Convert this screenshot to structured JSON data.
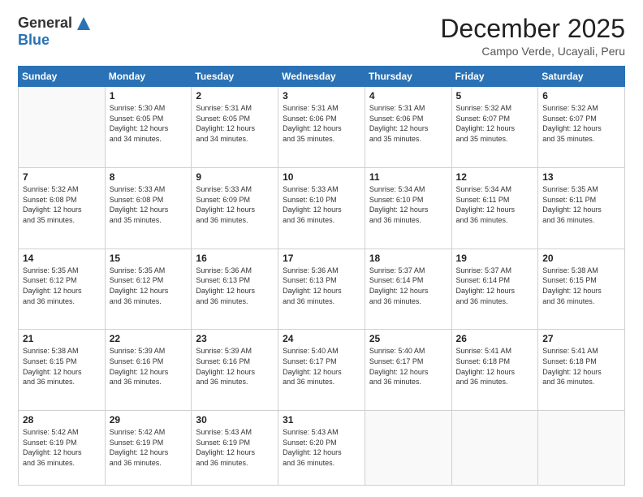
{
  "logo": {
    "general": "General",
    "blue": "Blue"
  },
  "title": {
    "month": "December 2025",
    "location": "Campo Verde, Ucayali, Peru"
  },
  "weekdays": [
    "Sunday",
    "Monday",
    "Tuesday",
    "Wednesday",
    "Thursday",
    "Friday",
    "Saturday"
  ],
  "weeks": [
    [
      {
        "day": "",
        "info": ""
      },
      {
        "day": "1",
        "info": "Sunrise: 5:30 AM\nSunset: 6:05 PM\nDaylight: 12 hours\nand 34 minutes."
      },
      {
        "day": "2",
        "info": "Sunrise: 5:31 AM\nSunset: 6:05 PM\nDaylight: 12 hours\nand 34 minutes."
      },
      {
        "day": "3",
        "info": "Sunrise: 5:31 AM\nSunset: 6:06 PM\nDaylight: 12 hours\nand 35 minutes."
      },
      {
        "day": "4",
        "info": "Sunrise: 5:31 AM\nSunset: 6:06 PM\nDaylight: 12 hours\nand 35 minutes."
      },
      {
        "day": "5",
        "info": "Sunrise: 5:32 AM\nSunset: 6:07 PM\nDaylight: 12 hours\nand 35 minutes."
      },
      {
        "day": "6",
        "info": "Sunrise: 5:32 AM\nSunset: 6:07 PM\nDaylight: 12 hours\nand 35 minutes."
      }
    ],
    [
      {
        "day": "7",
        "info": "Sunrise: 5:32 AM\nSunset: 6:08 PM\nDaylight: 12 hours\nand 35 minutes."
      },
      {
        "day": "8",
        "info": "Sunrise: 5:33 AM\nSunset: 6:08 PM\nDaylight: 12 hours\nand 35 minutes."
      },
      {
        "day": "9",
        "info": "Sunrise: 5:33 AM\nSunset: 6:09 PM\nDaylight: 12 hours\nand 36 minutes."
      },
      {
        "day": "10",
        "info": "Sunrise: 5:33 AM\nSunset: 6:10 PM\nDaylight: 12 hours\nand 36 minutes."
      },
      {
        "day": "11",
        "info": "Sunrise: 5:34 AM\nSunset: 6:10 PM\nDaylight: 12 hours\nand 36 minutes."
      },
      {
        "day": "12",
        "info": "Sunrise: 5:34 AM\nSunset: 6:11 PM\nDaylight: 12 hours\nand 36 minutes."
      },
      {
        "day": "13",
        "info": "Sunrise: 5:35 AM\nSunset: 6:11 PM\nDaylight: 12 hours\nand 36 minutes."
      }
    ],
    [
      {
        "day": "14",
        "info": "Sunrise: 5:35 AM\nSunset: 6:12 PM\nDaylight: 12 hours\nand 36 minutes."
      },
      {
        "day": "15",
        "info": "Sunrise: 5:35 AM\nSunset: 6:12 PM\nDaylight: 12 hours\nand 36 minutes."
      },
      {
        "day": "16",
        "info": "Sunrise: 5:36 AM\nSunset: 6:13 PM\nDaylight: 12 hours\nand 36 minutes."
      },
      {
        "day": "17",
        "info": "Sunrise: 5:36 AM\nSunset: 6:13 PM\nDaylight: 12 hours\nand 36 minutes."
      },
      {
        "day": "18",
        "info": "Sunrise: 5:37 AM\nSunset: 6:14 PM\nDaylight: 12 hours\nand 36 minutes."
      },
      {
        "day": "19",
        "info": "Sunrise: 5:37 AM\nSunset: 6:14 PM\nDaylight: 12 hours\nand 36 minutes."
      },
      {
        "day": "20",
        "info": "Sunrise: 5:38 AM\nSunset: 6:15 PM\nDaylight: 12 hours\nand 36 minutes."
      }
    ],
    [
      {
        "day": "21",
        "info": "Sunrise: 5:38 AM\nSunset: 6:15 PM\nDaylight: 12 hours\nand 36 minutes."
      },
      {
        "day": "22",
        "info": "Sunrise: 5:39 AM\nSunset: 6:16 PM\nDaylight: 12 hours\nand 36 minutes."
      },
      {
        "day": "23",
        "info": "Sunrise: 5:39 AM\nSunset: 6:16 PM\nDaylight: 12 hours\nand 36 minutes."
      },
      {
        "day": "24",
        "info": "Sunrise: 5:40 AM\nSunset: 6:17 PM\nDaylight: 12 hours\nand 36 minutes."
      },
      {
        "day": "25",
        "info": "Sunrise: 5:40 AM\nSunset: 6:17 PM\nDaylight: 12 hours\nand 36 minutes."
      },
      {
        "day": "26",
        "info": "Sunrise: 5:41 AM\nSunset: 6:18 PM\nDaylight: 12 hours\nand 36 minutes."
      },
      {
        "day": "27",
        "info": "Sunrise: 5:41 AM\nSunset: 6:18 PM\nDaylight: 12 hours\nand 36 minutes."
      }
    ],
    [
      {
        "day": "28",
        "info": "Sunrise: 5:42 AM\nSunset: 6:19 PM\nDaylight: 12 hours\nand 36 minutes."
      },
      {
        "day": "29",
        "info": "Sunrise: 5:42 AM\nSunset: 6:19 PM\nDaylight: 12 hours\nand 36 minutes."
      },
      {
        "day": "30",
        "info": "Sunrise: 5:43 AM\nSunset: 6:19 PM\nDaylight: 12 hours\nand 36 minutes."
      },
      {
        "day": "31",
        "info": "Sunrise: 5:43 AM\nSunset: 6:20 PM\nDaylight: 12 hours\nand 36 minutes."
      },
      {
        "day": "",
        "info": ""
      },
      {
        "day": "",
        "info": ""
      },
      {
        "day": "",
        "info": ""
      }
    ]
  ]
}
